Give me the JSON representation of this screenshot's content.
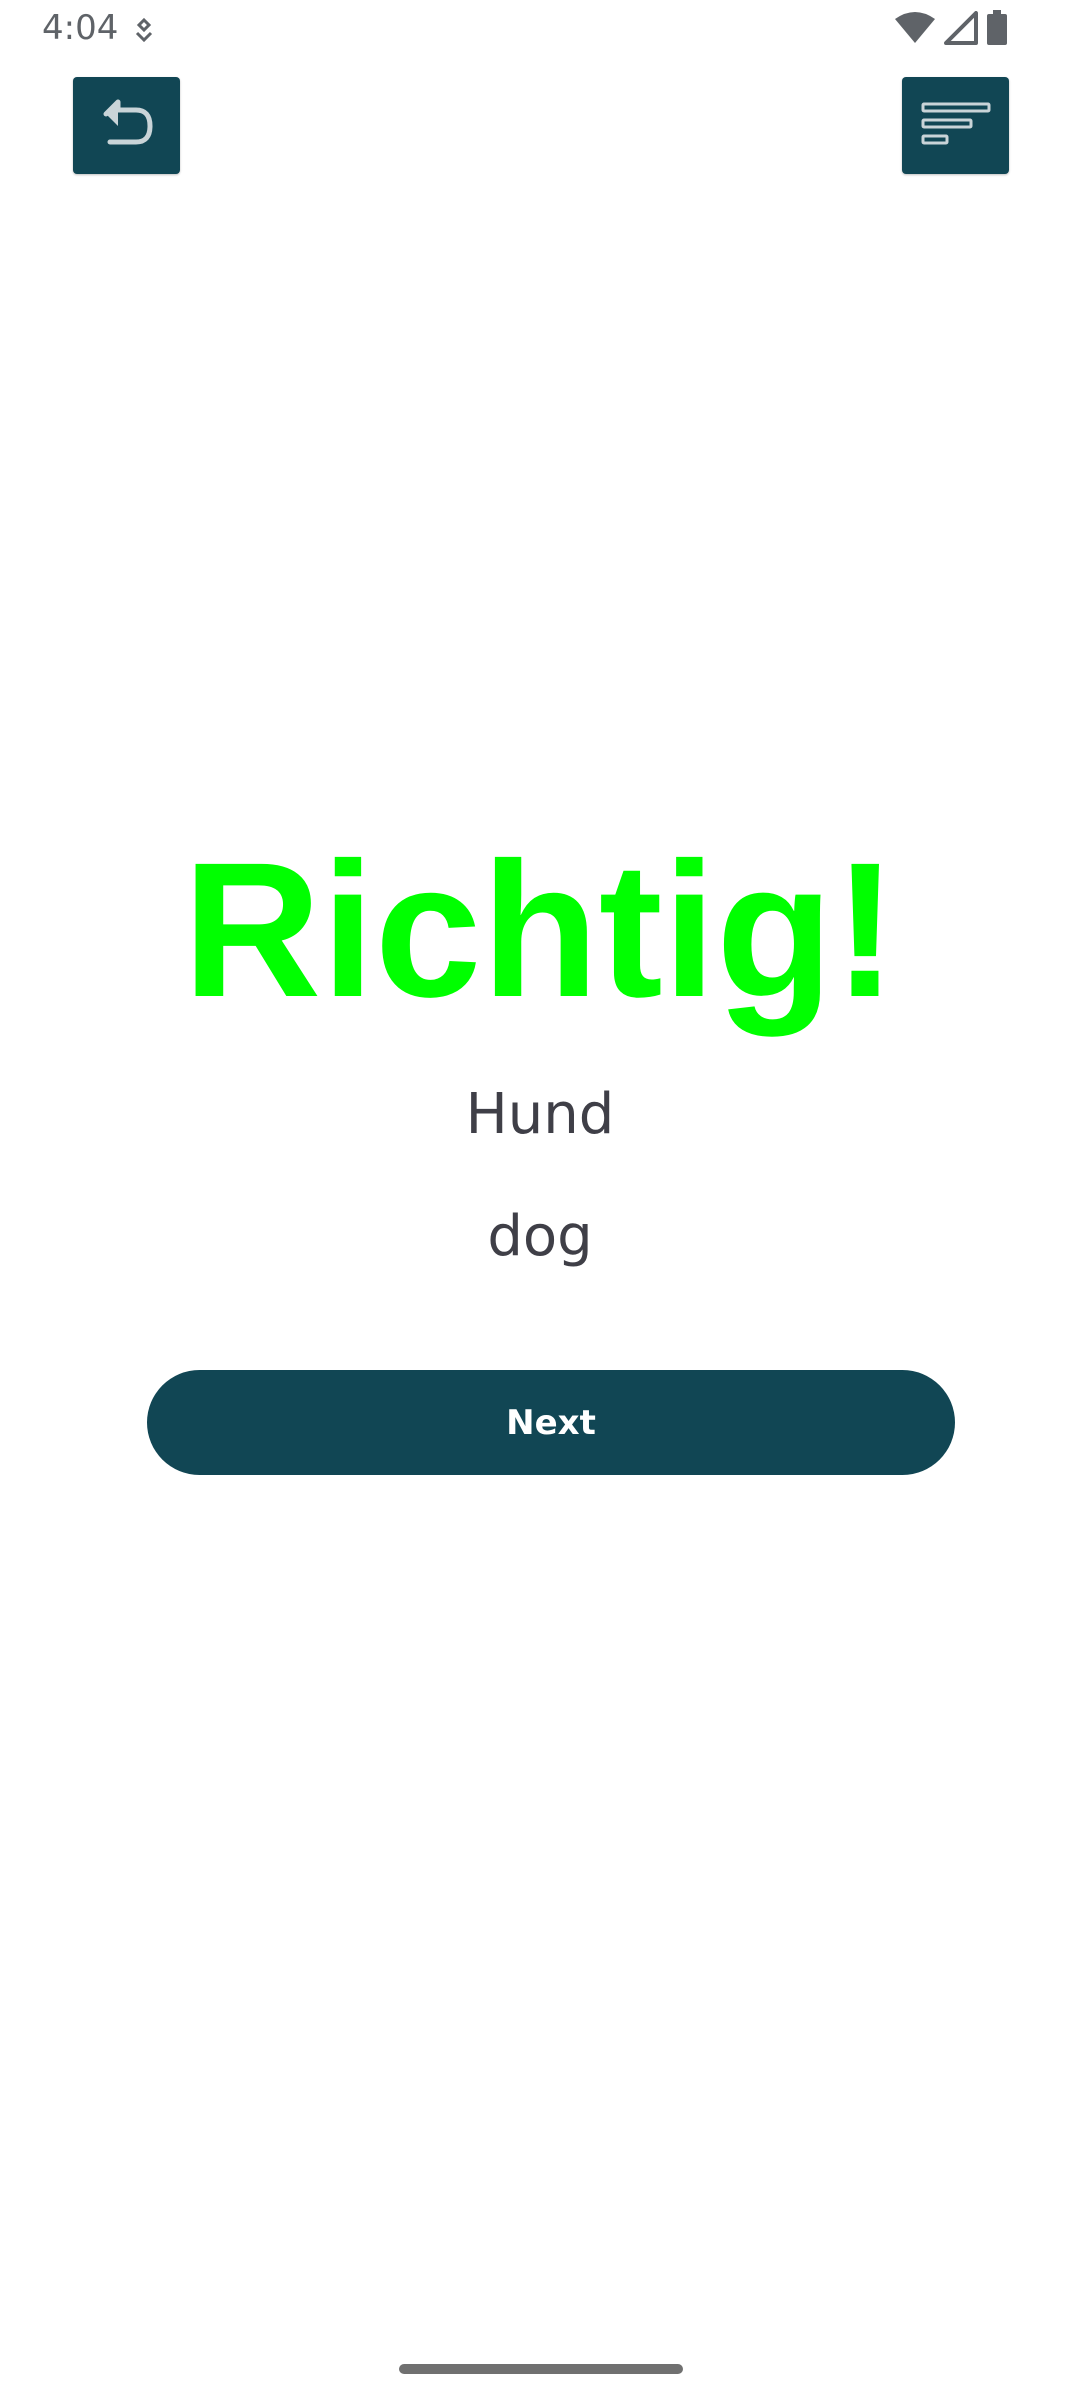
{
  "status_bar": {
    "time": "4:04",
    "icons": [
      "notification-icon",
      "wifi-icon",
      "cellular-signal-icon",
      "battery-icon"
    ]
  },
  "toolbar": {
    "left_icon": "undo-icon",
    "right_icon": "menu-lines-icon"
  },
  "result": {
    "title": "Richtig!",
    "german_word": "Hund",
    "translation": "dog",
    "next_label": "Next"
  },
  "colors": {
    "accent": "#114654",
    "success": "#00ff00",
    "text": "#3f3f47"
  }
}
